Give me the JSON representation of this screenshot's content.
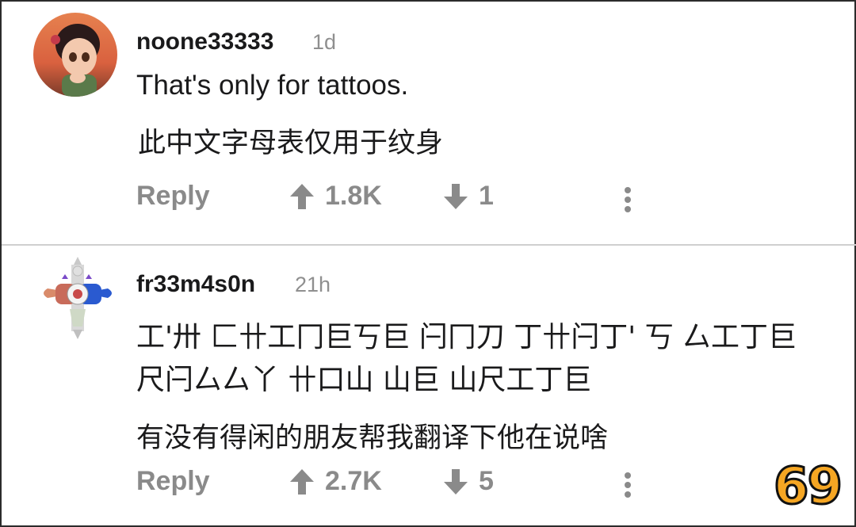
{
  "comments": [
    {
      "username": "noone33333",
      "age": "1d",
      "lines": [
        "That's only for tattoos.",
        "此中文字母表仅用于纹身"
      ],
      "reply_label": "Reply",
      "upvotes": "1.8K",
      "downvotes": "1"
    },
    {
      "username": "fr33m4s0n",
      "age": "21h",
      "lines": [
        "工'卅 匚卄工冂巨丂巨 闩冂刀 丁卄闩丁' 丂 厶工丁巨",
        "尺闩厶厶丫 卄口山 山巨 山尺工丁巨",
        "有没有得闲的朋友帮我翻译下他在说啥"
      ],
      "reply_label": "Reply",
      "upvotes": "2.7K",
      "downvotes": "5"
    }
  ],
  "badge": "69",
  "icons": {
    "upvote": "arrow-up-icon",
    "downvote": "arrow-down-icon",
    "more": "more-vertical-icon"
  },
  "colors": {
    "text": "#1a1a1b",
    "muted": "#8a8a8a",
    "badge": "#f5a623"
  }
}
